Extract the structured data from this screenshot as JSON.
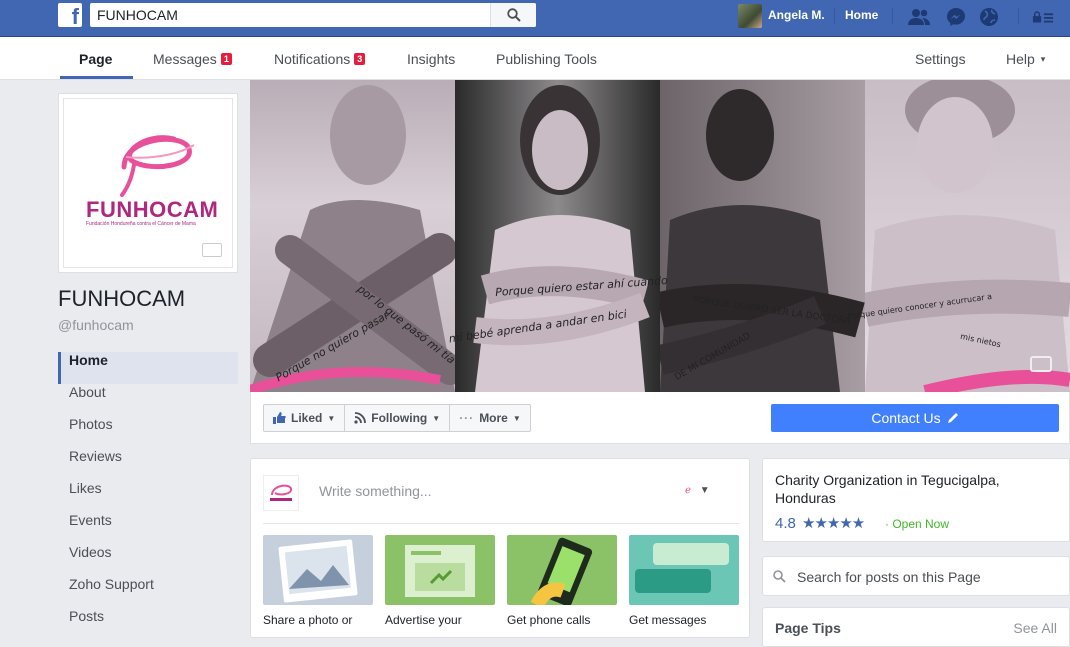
{
  "topbar": {
    "logo": "f",
    "search_value": "FUNHOCAM",
    "user_name": "Angela M.",
    "home_label": "Home",
    "icons": [
      "friend-requests-icon",
      "messenger-icon",
      "notifications-globe-icon",
      "lock-icon"
    ]
  },
  "tabs": [
    {
      "label": "Page"
    },
    {
      "label": "Messages",
      "badge": "1"
    },
    {
      "label": "Notifications",
      "badge": "3"
    },
    {
      "label": "Insights"
    },
    {
      "label": "Publishing Tools"
    },
    {
      "label": "Settings"
    },
    {
      "label": "Help"
    }
  ],
  "profile": {
    "logo_text": "FUNHOCAM",
    "logo_subtitle": "Fundación Hondureña contra el Cáncer de Mama",
    "name": "FUNHOCAM",
    "handle": "@funhocam"
  },
  "nav": [
    "Home",
    "About",
    "Photos",
    "Reviews",
    "Likes",
    "Events",
    "Videos",
    "Zoho Support",
    "Posts"
  ],
  "cover": {
    "texts": [
      "Porque no quiero pasar",
      "por lo que pasó mi tía",
      "Porque quiero estar ahí cuando",
      "mi bebé aprenda a andar en bici",
      "PORQUE QUIERO SER LA DOCTORA",
      "DE MI COMUNIDAD",
      "Porque quiero conocer y acurrucar a",
      "mis nietos"
    ]
  },
  "actions": {
    "liked": "Liked",
    "following": "Following",
    "more": "More",
    "contact": "Contact Us"
  },
  "composer": {
    "placeholder": "Write something...",
    "tiles": [
      "Share a photo or",
      "Advertise your",
      "Get phone calls",
      "Get messages"
    ]
  },
  "info": {
    "category": "Charity Organization in Tegucigalpa, Honduras",
    "rating": "4.8",
    "stars": "★★★★★",
    "status": "· Open Now"
  },
  "page_search_placeholder": "Search for posts on this Page",
  "tips": {
    "title": "Page Tips",
    "see_all": "See All"
  },
  "colors": {
    "brand": "#4267b2",
    "accent_pink": "#e8519a",
    "contact": "#4080ff"
  }
}
